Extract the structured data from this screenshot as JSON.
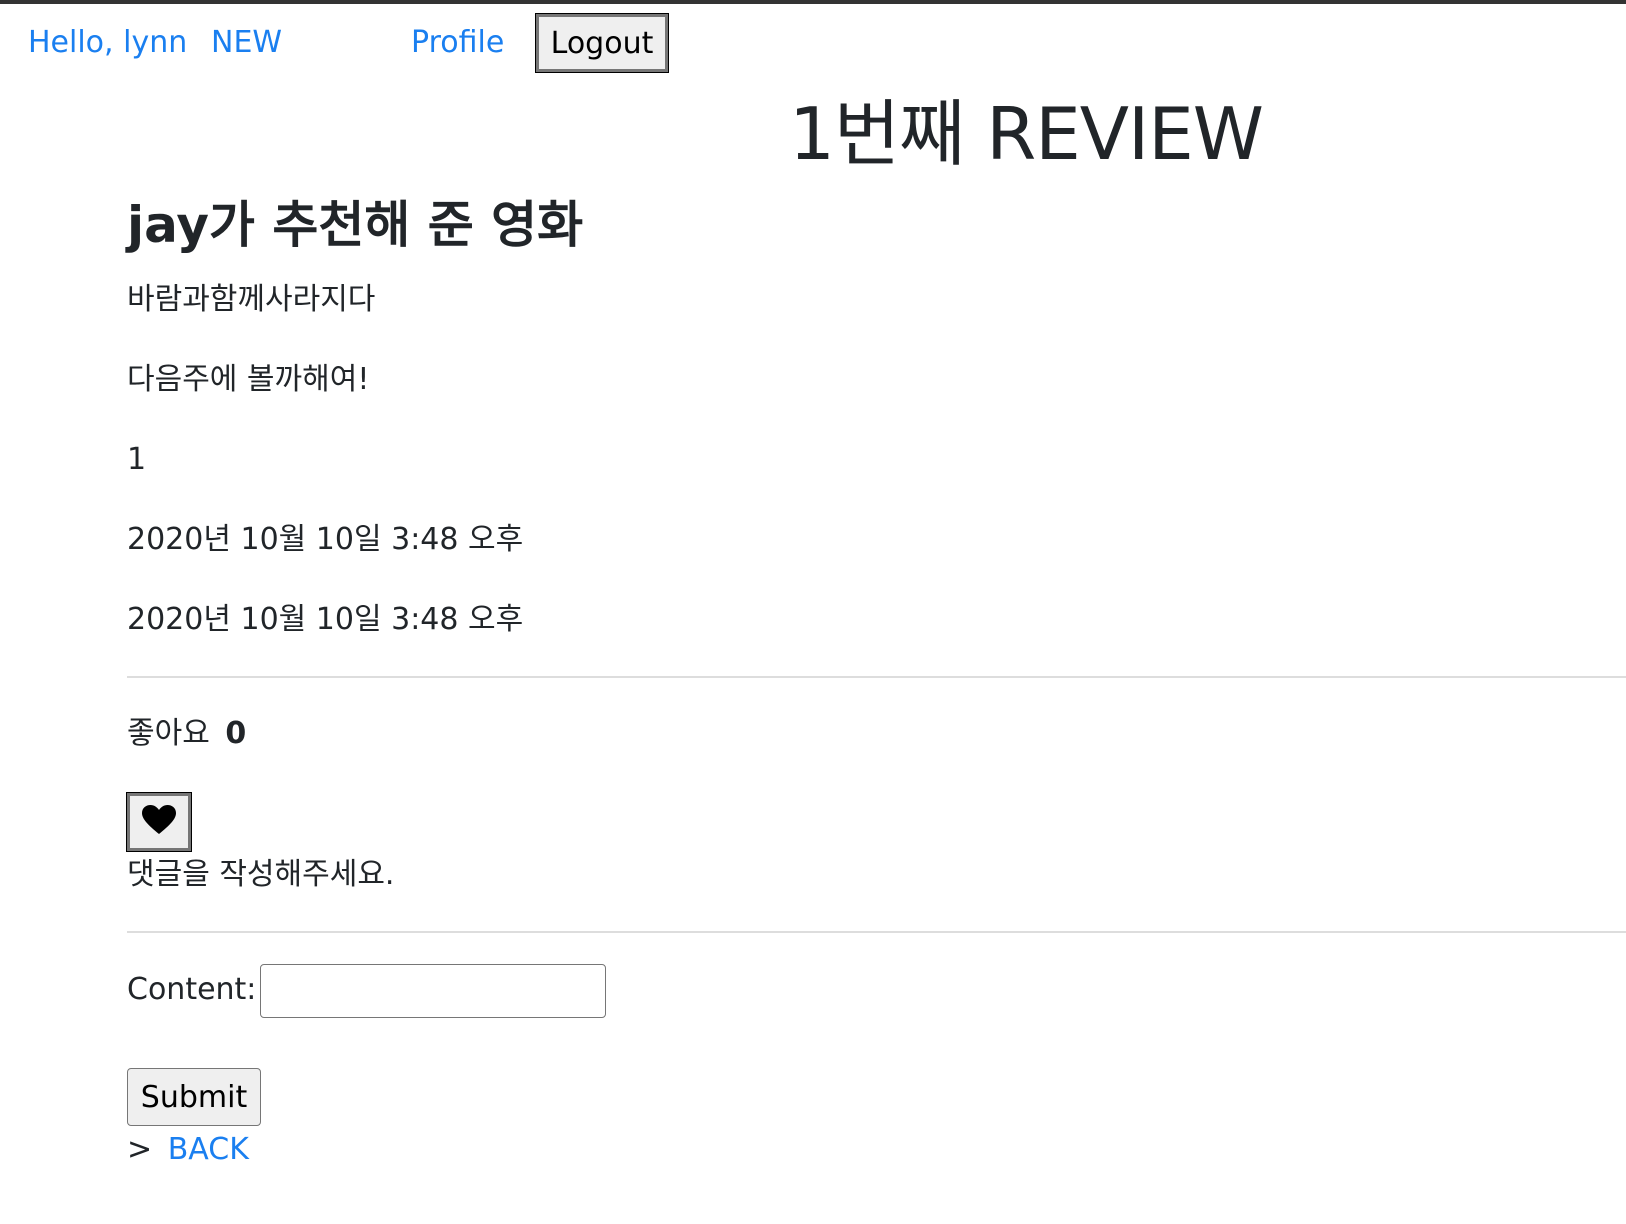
{
  "nav": {
    "hello": "Hello, lynn",
    "new": "NEW",
    "profile": "Profile",
    "logout": "Logout"
  },
  "page": {
    "title": "1번째 REVIEW"
  },
  "review": {
    "title": "jay가 추천해 준 영화",
    "movie_title": "바람과함께사라지다",
    "content": "다음주에 볼까해여!",
    "rank": "1",
    "created_at": "2020년 10월 10일 3:48 오후",
    "updated_at": "2020년 10월 10일 3:48 오후"
  },
  "likes": {
    "label": "좋아요",
    "count": "0",
    "button_icon": "heart-icon"
  },
  "comments": {
    "empty_message": "댓글을 작성해주세요.",
    "content_label": "Content:",
    "content_value": "",
    "submit_label": "Submit"
  },
  "footer": {
    "prefix": ">",
    "back_label": "BACK"
  },
  "colors": {
    "link": "#1a7ff0",
    "text": "#212529",
    "divider": "#dddddd"
  }
}
